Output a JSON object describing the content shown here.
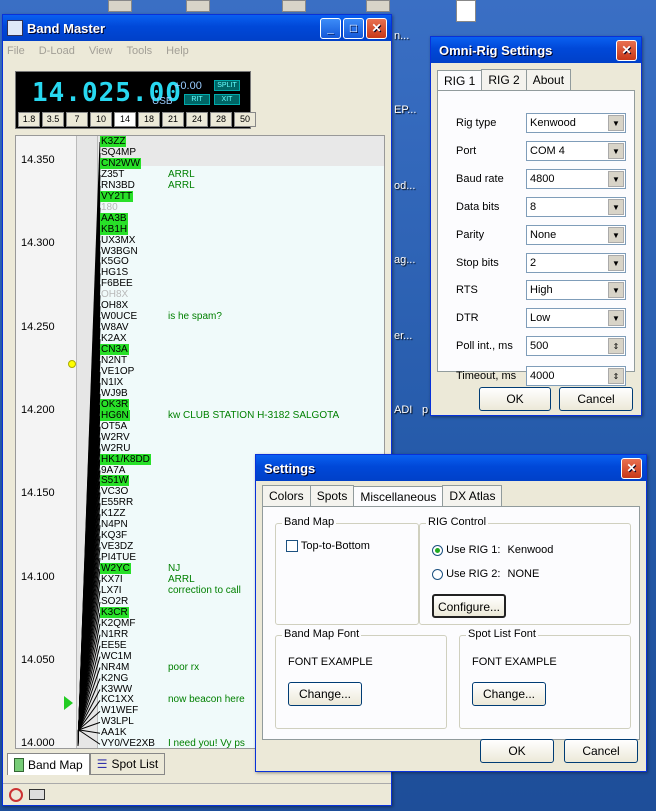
{
  "desktop": {
    "labels": [
      "n...",
      "EP...",
      "od...",
      "ag...",
      "er...",
      "ADI",
      "p"
    ]
  },
  "bandmaster": {
    "title": "Band Master",
    "menu": [
      "File",
      "D-Load",
      "View",
      "Tools",
      "Help"
    ],
    "frequency": "14.025.00",
    "offset": "+0.00",
    "mode": "USB",
    "buttons": [
      "SPLIT",
      "RIT",
      "XIT"
    ],
    "bands": [
      "1.8",
      "3.5",
      "7",
      "10",
      "14",
      "18",
      "21",
      "24",
      "28",
      "50"
    ],
    "active_band": "14",
    "scale_labels": [
      "14.350",
      "14.300",
      "14.250",
      "14.200",
      "14.150",
      "14.100",
      "14.050",
      "14.000"
    ],
    "spots": [
      {
        "call": "K3ZZ",
        "hl": true,
        "comment": ""
      },
      {
        "call": "SQ4MP",
        "hl": false,
        "comment": ""
      },
      {
        "call": "CN2WW",
        "hl": true,
        "comment": ""
      },
      {
        "call": "Z35T",
        "hl": false,
        "comment": "ARRL"
      },
      {
        "call": "RN3BD",
        "hl": false,
        "comment": "ARRL"
      },
      {
        "call": "VY2TT",
        "hl": true,
        "comment": ""
      },
      {
        "call": "180",
        "hl": false,
        "faded": true,
        "comment": ""
      },
      {
        "call": "AA3B",
        "hl": true,
        "comment": ""
      },
      {
        "call": "KB1H",
        "hl": true,
        "comment": ""
      },
      {
        "call": "UX3MX",
        "hl": false,
        "comment": ""
      },
      {
        "call": "W3BGN",
        "hl": false,
        "comment": ""
      },
      {
        "call": "K5GO",
        "hl": false,
        "comment": ""
      },
      {
        "call": "HG1S",
        "hl": false,
        "comment": ""
      },
      {
        "call": "F6BEE",
        "hl": false,
        "comment": ""
      },
      {
        "call": "OH8X",
        "hl": false,
        "faded": true,
        "comment": ""
      },
      {
        "call": "OH8X",
        "hl": false,
        "comment": ""
      },
      {
        "call": "W0UCE",
        "hl": false,
        "comment": "is he spam?"
      },
      {
        "call": "W8AV",
        "hl": false,
        "comment": ""
      },
      {
        "call": "K2AX",
        "hl": false,
        "comment": ""
      },
      {
        "call": "CN3A",
        "hl": true,
        "comment": ""
      },
      {
        "call": "N2NT",
        "hl": false,
        "comment": ""
      },
      {
        "call": "VE1OP",
        "hl": false,
        "comment": ""
      },
      {
        "call": "N1IX",
        "hl": false,
        "comment": ""
      },
      {
        "call": "WJ9B",
        "hl": false,
        "comment": ""
      },
      {
        "call": "OK3R",
        "hl": true,
        "comment": ""
      },
      {
        "call": "HG6N",
        "hl": true,
        "comment": "kw CLUB STATION H-3182 SALGOTA"
      },
      {
        "call": "OT5A",
        "hl": false,
        "comment": ""
      },
      {
        "call": "W2RV",
        "hl": false,
        "comment": ""
      },
      {
        "call": "W2RU",
        "hl": false,
        "comment": ""
      },
      {
        "call": "HK1/K8DD",
        "hl": true,
        "comment": ""
      },
      {
        "call": "9A7A",
        "hl": false,
        "comment": ""
      },
      {
        "call": "S51W",
        "hl": true,
        "comment": ""
      },
      {
        "call": "VC3O",
        "hl": false,
        "comment": ""
      },
      {
        "call": "E55RR",
        "hl": false,
        "comment": ""
      },
      {
        "call": "K1ZZ",
        "hl": false,
        "comment": ""
      },
      {
        "call": "N4PN",
        "hl": false,
        "comment": ""
      },
      {
        "call": "KQ3F",
        "hl": false,
        "comment": ""
      },
      {
        "call": "VE3DZ",
        "hl": false,
        "comment": ""
      },
      {
        "call": "PI4TUE",
        "hl": false,
        "comment": ""
      },
      {
        "call": "W2YC",
        "hl": true,
        "comment": "NJ"
      },
      {
        "call": "KX7I",
        "hl": false,
        "comment": "ARRL"
      },
      {
        "call": "LX7I",
        "hl": false,
        "comment": "correction to call"
      },
      {
        "call": "SO2R",
        "hl": false,
        "comment": ""
      },
      {
        "call": "K3CR",
        "hl": true,
        "comment": ""
      },
      {
        "call": "K2QMF",
        "hl": false,
        "comment": ""
      },
      {
        "call": "N1RR",
        "hl": false,
        "comment": ""
      },
      {
        "call": "EE5E",
        "hl": false,
        "comment": ""
      },
      {
        "call": "WC1M",
        "hl": false,
        "comment": ""
      },
      {
        "call": "NR4M",
        "hl": false,
        "comment": "poor rx"
      },
      {
        "call": "K2NG",
        "hl": false,
        "comment": ""
      },
      {
        "call": "K3WW",
        "hl": false,
        "comment": ""
      },
      {
        "call": "KC1XX",
        "hl": false,
        "comment": "now beacon here"
      },
      {
        "call": "W1WEF",
        "hl": false,
        "comment": ""
      },
      {
        "call": "W3LPL",
        "hl": false,
        "comment": ""
      },
      {
        "call": "AA1K",
        "hl": false,
        "comment": ""
      },
      {
        "call": "VY0/VE2XB",
        "hl": false,
        "comment": "I need you! Vy ps"
      }
    ],
    "tabs": [
      "Band Map",
      "Spot List"
    ]
  },
  "omnirig": {
    "title": "Omni-Rig Settings",
    "tabs": [
      "RIG 1",
      "RIG 2",
      "About"
    ],
    "fields": [
      {
        "label": "Rig type",
        "value": "Kenwood",
        "kind": "select"
      },
      {
        "label": "Port",
        "value": "COM 4",
        "kind": "select"
      },
      {
        "label": "Baud rate",
        "value": "4800",
        "kind": "select"
      },
      {
        "label": "Data bits",
        "value": "8",
        "kind": "select"
      },
      {
        "label": "Parity",
        "value": "None",
        "kind": "select"
      },
      {
        "label": "Stop bits",
        "value": "2",
        "kind": "select"
      },
      {
        "label": "RTS",
        "value": "High",
        "kind": "select"
      },
      {
        "label": "DTR",
        "value": "Low",
        "kind": "select"
      },
      {
        "label": "Poll int., ms",
        "value": "500",
        "kind": "spin"
      },
      {
        "label": "Timeout, ms",
        "value": "4000",
        "kind": "spin"
      }
    ],
    "ok": "OK",
    "cancel": "Cancel"
  },
  "settings": {
    "title": "Settings",
    "tabs": [
      "Colors",
      "Spots",
      "Miscellaneous",
      "DX Atlas"
    ],
    "band_map_group": "Band Map",
    "top_to_bottom": "Top-to-Bottom",
    "rig_control_group": "RIG Control",
    "use_rig1": "Use RIG 1:",
    "rig1_name": "Kenwood",
    "use_rig2": "Use RIG 2:",
    "rig2_name": "NONE",
    "configure": "Configure...",
    "band_map_font_group": "Band Map Font",
    "font_example_1": "FONT EXAMPLE",
    "change_1": "Change...",
    "spot_list_font_group": "Spot List Font",
    "font_example_2": "FONT EXAMPLE",
    "change_2": "Change...",
    "ok": "OK",
    "cancel": "Cancel"
  }
}
